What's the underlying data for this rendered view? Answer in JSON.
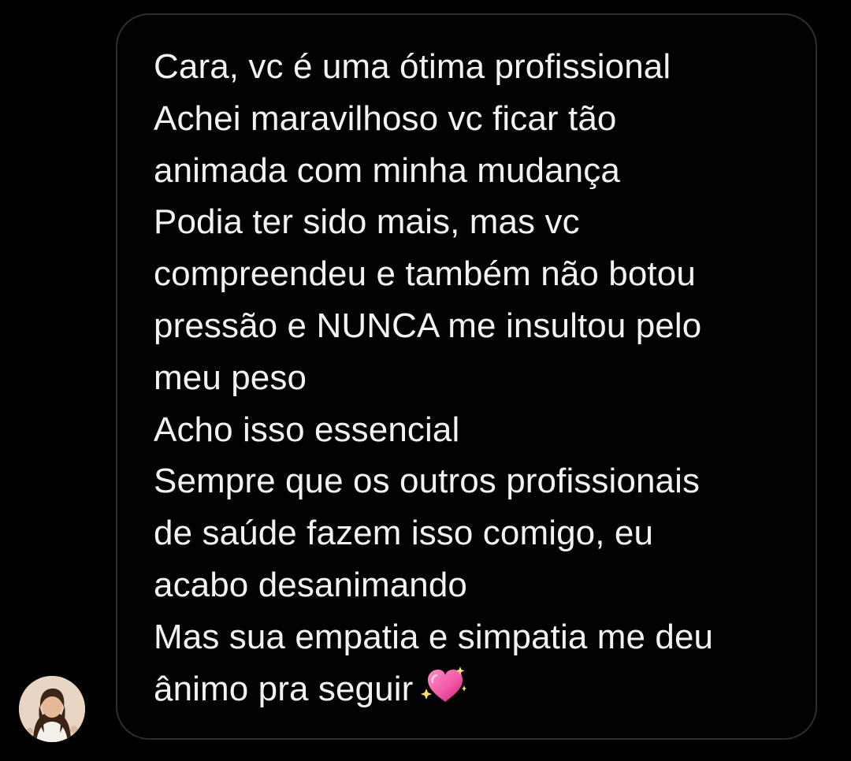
{
  "message": {
    "lines": [
      "Cara, vc é uma ótima profissional",
      "Achei maravilhoso vc ficar tão",
      "animada com minha mudança",
      "Podia ter sido mais, mas vc",
      "compreendeu e também não botou",
      "pressão e NUNCA me insultou pelo",
      "meu peso",
      "Acho isso essencial",
      "Sempre que os outros profissionais",
      "de saúde fazem isso comigo, eu",
      "acabo desanimando",
      "Mas sua empatia e simpatia me deu",
      "ânimo pra seguir"
    ],
    "trailing_emoji": "sparkling-heart-icon"
  },
  "sender": {
    "avatar": "sender-avatar"
  },
  "colors": {
    "background": "#000000",
    "bubble_border": "#2e2e30",
    "text": "#f2f2f2",
    "emoji_heart": "#f25aa6"
  }
}
